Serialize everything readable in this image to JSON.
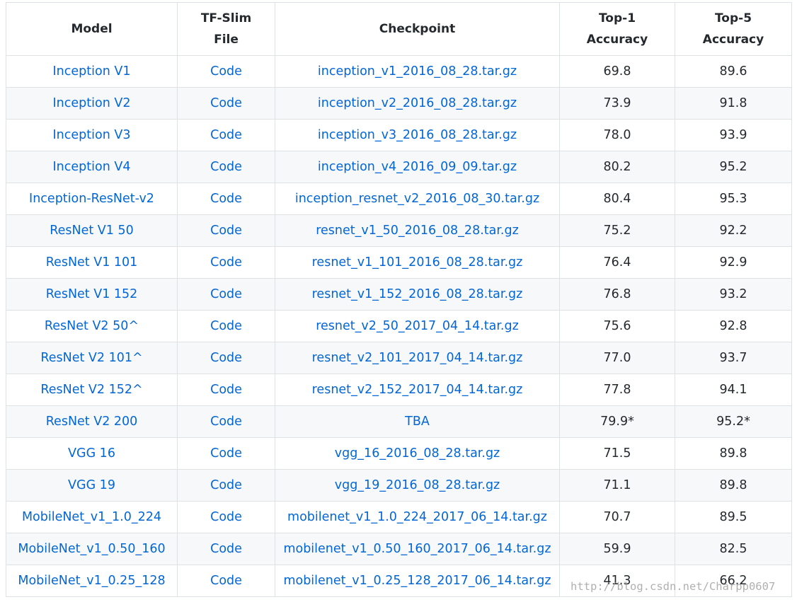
{
  "colors": {
    "link": "#0366d6",
    "text": "#24292e",
    "border": "#dfe2e5",
    "stripe": "#f6f8fa"
  },
  "table": {
    "headers": [
      "Model",
      "TF-Slim File",
      "Checkpoint",
      "Top-1 Accuracy",
      "Top-5 Accuracy"
    ],
    "rows": [
      [
        "Inception V1",
        "Code",
        "inception_v1_2016_08_28.tar.gz",
        "69.8",
        "89.6"
      ],
      [
        "Inception V2",
        "Code",
        "inception_v2_2016_08_28.tar.gz",
        "73.9",
        "91.8"
      ],
      [
        "Inception V3",
        "Code",
        "inception_v3_2016_08_28.tar.gz",
        "78.0",
        "93.9"
      ],
      [
        "Inception V4",
        "Code",
        "inception_v4_2016_09_09.tar.gz",
        "80.2",
        "95.2"
      ],
      [
        "Inception-ResNet-v2",
        "Code",
        "inception_resnet_v2_2016_08_30.tar.gz",
        "80.4",
        "95.3"
      ],
      [
        "ResNet V1 50",
        "Code",
        "resnet_v1_50_2016_08_28.tar.gz",
        "75.2",
        "92.2"
      ],
      [
        "ResNet V1 101",
        "Code",
        "resnet_v1_101_2016_08_28.tar.gz",
        "76.4",
        "92.9"
      ],
      [
        "ResNet V1 152",
        "Code",
        "resnet_v1_152_2016_08_28.tar.gz",
        "76.8",
        "93.2"
      ],
      [
        "ResNet V2 50^",
        "Code",
        "resnet_v2_50_2017_04_14.tar.gz",
        "75.6",
        "92.8"
      ],
      [
        "ResNet V2 101^",
        "Code",
        "resnet_v2_101_2017_04_14.tar.gz",
        "77.0",
        "93.7"
      ],
      [
        "ResNet V2 152^",
        "Code",
        "resnet_v2_152_2017_04_14.tar.gz",
        "77.8",
        "94.1"
      ],
      [
        "ResNet V2 200",
        "Code",
        "TBA",
        "79.9*",
        "95.2*"
      ],
      [
        "VGG 16",
        "Code",
        "vgg_16_2016_08_28.tar.gz",
        "71.5",
        "89.8"
      ],
      [
        "VGG 19",
        "Code",
        "vgg_19_2016_08_28.tar.gz",
        "71.1",
        "89.8"
      ],
      [
        "MobileNet_v1_1.0_224",
        "Code",
        "mobilenet_v1_1.0_224_2017_06_14.tar.gz",
        "70.7",
        "89.5"
      ],
      [
        "MobileNet_v1_0.50_160",
        "Code",
        "mobilenet_v1_0.50_160_2017_06_14.tar.gz",
        "59.9",
        "82.5"
      ],
      [
        "MobileNet_v1_0.25_128",
        "Code",
        "mobilenet_v1_0.25_128_2017_06_14.tar.gz",
        "41.3",
        "66.2"
      ]
    ]
  },
  "watermark": "http://blog.csdn.net/Charpp0607"
}
